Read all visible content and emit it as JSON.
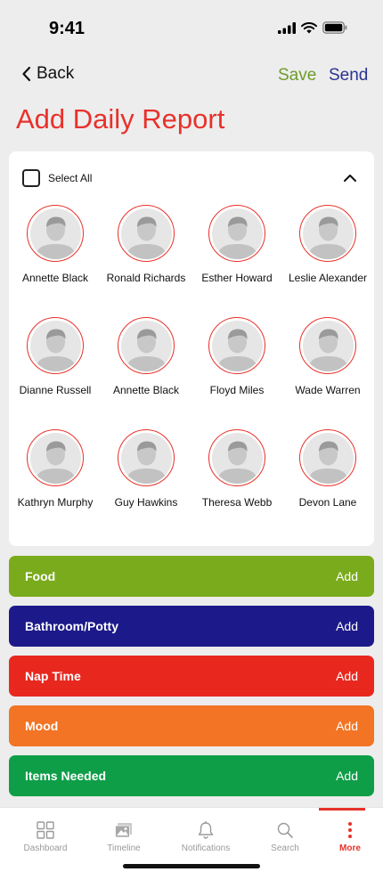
{
  "status": {
    "time": "9:41"
  },
  "nav": {
    "back_label": "Back",
    "save_label": "Save",
    "send_label": "Send"
  },
  "title": "Add Daily Report",
  "children": {
    "select_all_label": "Select All",
    "items": [
      {
        "name": "Annette Black"
      },
      {
        "name": "Ronald Richards"
      },
      {
        "name": "Esther Howard"
      },
      {
        "name": "Leslie Alexander"
      },
      {
        "name": "Dianne Russell"
      },
      {
        "name": "Annette Black"
      },
      {
        "name": "Floyd Miles"
      },
      {
        "name": "Wade Warren"
      },
      {
        "name": "Kathryn Murphy"
      },
      {
        "name": "Guy Hawkins"
      },
      {
        "name": "Theresa Webb"
      },
      {
        "name": "Devon Lane"
      }
    ]
  },
  "categories": [
    {
      "label": "Food",
      "action": "Add",
      "color": "#7aab1c"
    },
    {
      "label": "Bathroom/Potty",
      "action": "Add",
      "color": "#1c1a8a"
    },
    {
      "label": "Nap Time",
      "action": "Add",
      "color": "#e8281f"
    },
    {
      "label": "Mood",
      "action": "Add",
      "color": "#f27424"
    },
    {
      "label": "Items Needed",
      "action": "Add",
      "color": "#0e9e48"
    }
  ],
  "tabbar": {
    "tabs": [
      {
        "label": "Dashboard",
        "icon": "grid-icon"
      },
      {
        "label": "Timeline",
        "icon": "image-icon"
      },
      {
        "label": "Notifications",
        "icon": "bell-icon"
      },
      {
        "label": "Search",
        "icon": "search-icon"
      },
      {
        "label": "More",
        "icon": "more-icon",
        "active": true
      }
    ]
  },
  "colors": {
    "accent": "#e8312b",
    "save": "#6e9c2a",
    "send": "#2b3490"
  }
}
